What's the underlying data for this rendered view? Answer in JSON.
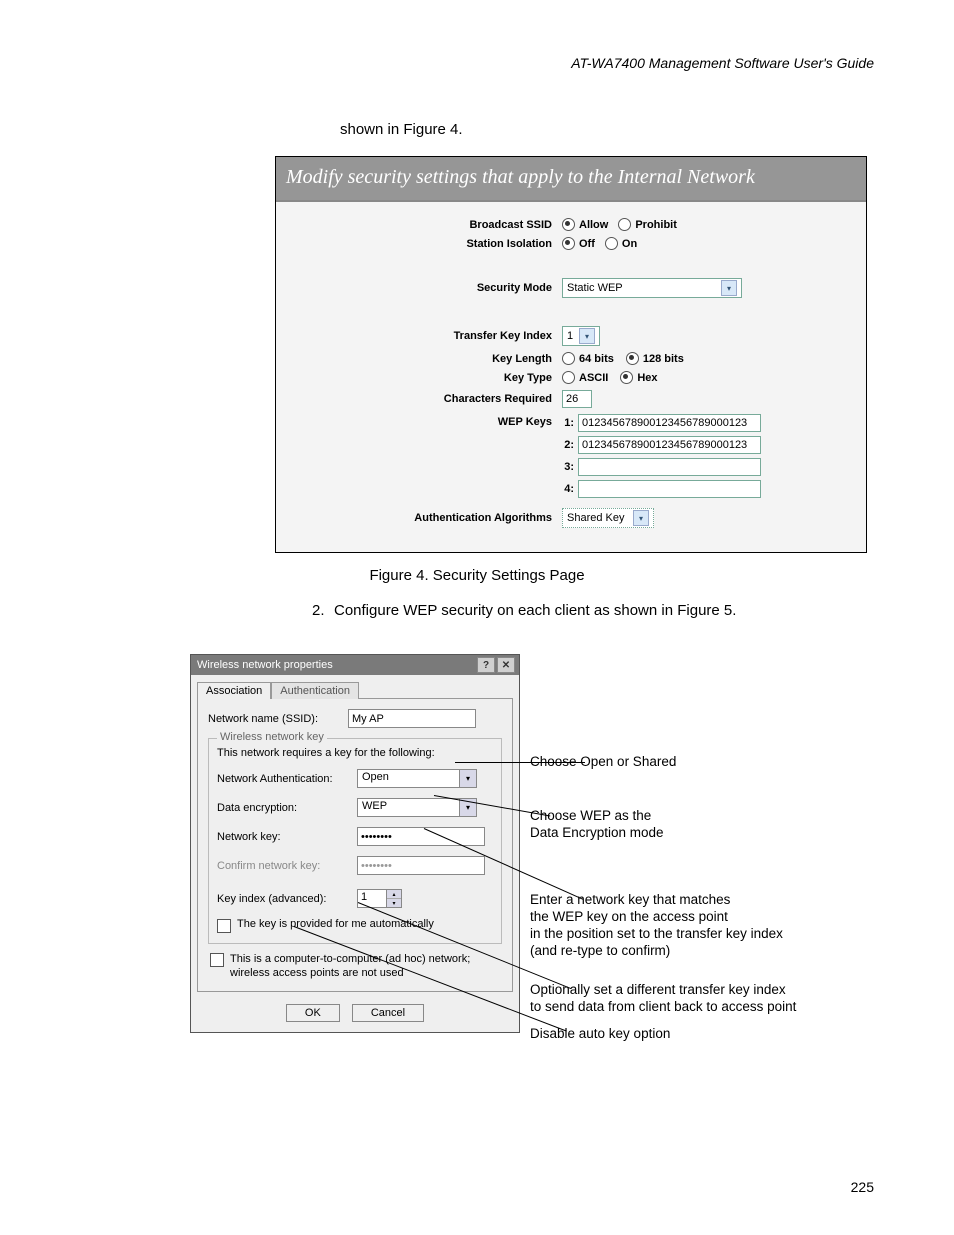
{
  "header": "AT-WA7400 Management Software User's Guide",
  "intro": "shown in Figure 4.",
  "fig4": {
    "title": "Modify security settings that apply to the Internal Network",
    "broadcast_label": "Broadcast SSID",
    "allow": "Allow",
    "prohibit": "Prohibit",
    "station_label": "Station Isolation",
    "off": "Off",
    "on": "On",
    "secmode_label": "Security Mode",
    "secmode_val": "Static WEP",
    "tki_label": "Transfer Key Index",
    "tki_val": "1",
    "keylen_label": "Key Length",
    "kl64": "64 bits",
    "kl128": "128 bits",
    "keytype_label": "Key Type",
    "kt_ascii": "ASCII",
    "kt_hex": "Hex",
    "chars_label": "Characters Required",
    "chars_val": "26",
    "wep_label": "WEP Keys",
    "wep1": "012345678900123456789000123",
    "wep2": "012345678900123456789000123",
    "wep3": "",
    "wep4": "",
    "auth_label": "Authentication Algorithms",
    "auth_val": "Shared Key"
  },
  "caption4": "Figure 4. Security Settings Page",
  "step2": "Configure WEP security on each client as shown in Figure 5.",
  "dialog": {
    "title": "Wireless network properties",
    "tab1": "Association",
    "tab2": "Authentication",
    "ssid_label": "Network name (SSID):",
    "ssid_val": "My AP",
    "legend": "Wireless network key",
    "legend_sub": "This network requires a key for the following:",
    "auth_label": "Network Authentication:",
    "auth_val": "Open",
    "enc_label": "Data encryption:",
    "enc_val": "WEP",
    "key_label": "Network key:",
    "key_val": "••••••••",
    "confirm_label": "Confirm network key:",
    "confirm_val": "••••••••",
    "idx_label": "Key index (advanced):",
    "idx_val": "1",
    "auto_label": "The key is provided for me automatically",
    "adhoc_label": "This is a computer-to-computer (ad hoc) network; wireless access points are not used",
    "ok": "OK",
    "cancel": "Cancel"
  },
  "callouts": {
    "c1": "Choose Open or Shared",
    "c2a": "Choose WEP as the",
    "c2b": "Data Encryption mode",
    "c3a": "Enter a network key that matches",
    "c3b": "the WEP key on the access point",
    "c3c": "in the position set to the transfer key index",
    "c3d": "(and re-type to confirm)",
    "c4a": "Optionally set a different transfer key index",
    "c4b": "to send data from client back to access point",
    "c5": "Disable auto key option"
  },
  "pagenum": "225"
}
